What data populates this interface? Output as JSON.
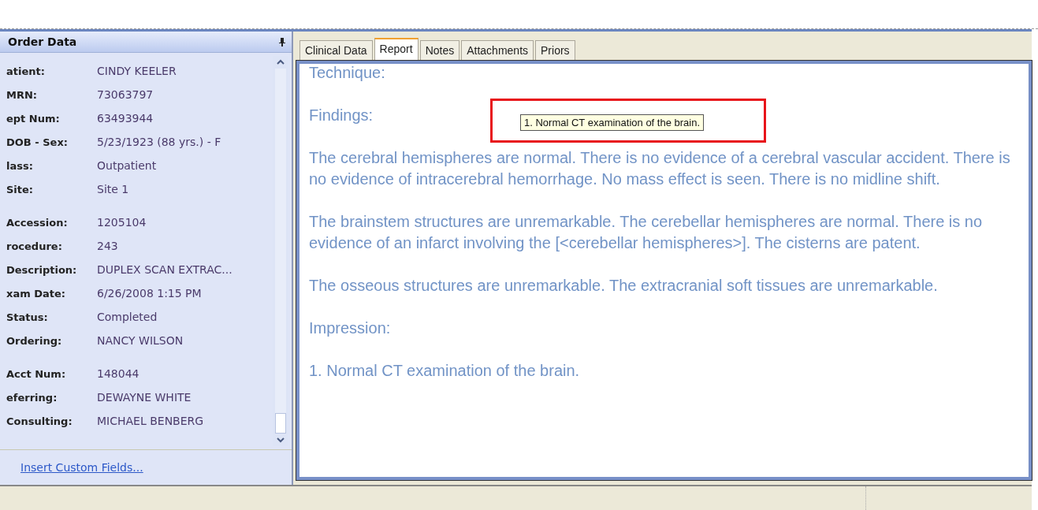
{
  "order_panel": {
    "title": "Order Data",
    "groups": [
      {
        "fields": [
          {
            "label": "atient:",
            "value": "CINDY KEELER"
          },
          {
            "label": "MRN:",
            "value": "73063797"
          },
          {
            "label": "ept Num:",
            "value": "63493944"
          },
          {
            "label": "DOB - Sex:",
            "value": "5/23/1923 (88 yrs.) - F"
          },
          {
            "label": "lass:",
            "value": "Outpatient"
          },
          {
            "label": "Site:",
            "value": "Site 1"
          }
        ]
      },
      {
        "fields": [
          {
            "label": "Accession:",
            "value": "1205104"
          },
          {
            "label": "rocedure:",
            "value": "243"
          },
          {
            "label": "Description:",
            "value": "DUPLEX SCAN EXTRAC..."
          },
          {
            "label": "xam Date:",
            "value": "6/26/2008 1:15 PM"
          },
          {
            "label": "Status:",
            "value": "Completed"
          },
          {
            "label": "Ordering:",
            "value": "NANCY WILSON"
          }
        ]
      },
      {
        "fields": [
          {
            "label": "Acct Num:",
            "value": "148044"
          },
          {
            "label": "eferring:",
            "value": "DEWAYNE WHITE"
          },
          {
            "label": "Consulting:",
            "value": "MICHAEL BENBERG"
          }
        ]
      }
    ],
    "link": "Insert Custom Fields..."
  },
  "tabs": [
    {
      "label": "Clinical Data",
      "selected": false
    },
    {
      "label": "Report",
      "selected": true
    },
    {
      "label": "Notes",
      "selected": false
    },
    {
      "label": "Attachments",
      "selected": false
    },
    {
      "label": "Priors",
      "selected": false
    }
  ],
  "report": {
    "paragraphs": [
      "Technique:",
      "Findings:",
      "The cerebral hemispheres are normal. There is no evidence of a cerebral vascular accident. There is no evidence of intracerebral hemorrhage. No mass effect is seen. There is no midline shift.",
      "The brainstem structures are unremarkable. The cerebellar hemispheres are normal. There is no evidence of an infarct involving the [<cerebellar hemispheres>]. The cisterns are patent.",
      "The osseous structures are unremarkable. The extracranial soft tissues are unremarkable.",
      "Impression:",
      "1. Normal CT examination of the brain."
    ],
    "tooltip": "1. Normal CT examination of the brain."
  }
}
